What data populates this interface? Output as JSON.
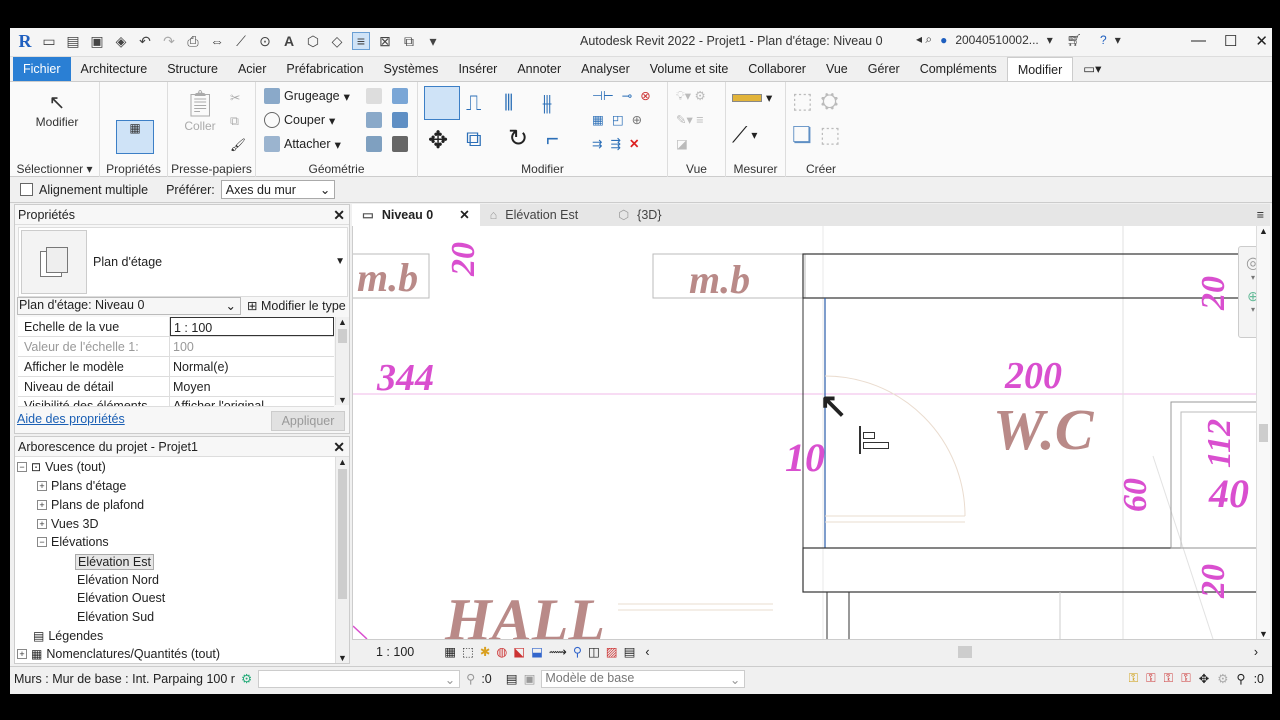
{
  "app": {
    "title": "Autodesk Revit 2022 - Projet1 - Plan d'étage: Niveau 0",
    "user": "20040510002...",
    "logo": "R"
  },
  "menu": {
    "tabs": [
      "Fichier",
      "Architecture",
      "Structure",
      "Acier",
      "Préfabrication",
      "Systèmes",
      "Insérer",
      "Annoter",
      "Analyser",
      "Volume et site",
      "Collaborer",
      "Vue",
      "Gérer",
      "Compléments",
      "Modifier"
    ],
    "active": "Modifier"
  },
  "ribbon": {
    "modifier_label": "Modifier",
    "coller_label": "Coller",
    "grugeage": "Grugeage",
    "couper": "Couper",
    "attacher": "Attacher",
    "panels": {
      "selectionner": "Sélectionner",
      "proprietes": "Propriétés",
      "presse_papiers": "Presse-papiers",
      "geometrie": "Géométrie",
      "modifier": "Modifier",
      "vue": "Vue",
      "mesurer": "Mesurer",
      "creer": "Créer"
    }
  },
  "options": {
    "alignement": "Alignement multiple",
    "preferer_label": "Préférer:",
    "preferer_value": "Axes du mur"
  },
  "properties": {
    "title": "Propriétés",
    "type_name": "Plan d'étage",
    "selector": "Plan d'étage: Niveau 0",
    "modify_type": "Modifier le type",
    "rows": [
      {
        "k": "Echelle de la vue",
        "v": "1 : 100"
      },
      {
        "k": "Valeur de l'échelle    1:",
        "v": "100"
      },
      {
        "k": "Afficher le modèle",
        "v": "Normal(e)"
      },
      {
        "k": "Niveau de détail",
        "v": "Moyen"
      },
      {
        "k": "Visibilité des éléments",
        "v": "Afficher l'original"
      }
    ],
    "help": "Aide des propriétés",
    "apply": "Appliquer"
  },
  "tree": {
    "title": "Arborescence du projet - Projet1",
    "items": {
      "vues": "Vues (tout)",
      "plans_etage": "Plans d'étage",
      "plans_plafond": "Plans de plafond",
      "vues3d": "Vues 3D",
      "elevations": "Elévations",
      "elev_est": "Elévation Est",
      "elev_nord": "Elévation Nord",
      "elev_ouest": "Elévation Ouest",
      "elev_sud": "Elévation Sud",
      "legendes": "Légendes",
      "nomenclatures": "Nomenclatures/Quantités (tout)"
    }
  },
  "viewtabs": {
    "niveau0": "Niveau 0",
    "elev_est": "Elévation Est",
    "view3d": "{3D}"
  },
  "canvas": {
    "labels": {
      "mb1": "m.b",
      "mb2": "m.b",
      "d20a": "20",
      "d344": "344",
      "d200": "200",
      "wc": "W.C",
      "d10": "10",
      "d60": "60",
      "d20b": "20",
      "d112": "112",
      "d40": "40",
      "d20c": "20",
      "hall": "HALL"
    },
    "colors": {
      "dimension": "#d94fcf",
      "room": "#b98a88",
      "wall": "#333333"
    }
  },
  "viewcontrol": {
    "scale": "1 : 100"
  },
  "status": {
    "text": "Murs : Mur de base : Int. Parpaing 100 r",
    "filter_count": ":0",
    "model": "Modèle de base",
    "select_count": ":0"
  }
}
